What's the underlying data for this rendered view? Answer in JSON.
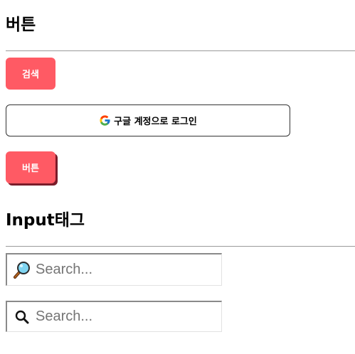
{
  "sections": {
    "buttons": {
      "title": "버튼"
    },
    "inputs": {
      "title": "Input태그"
    }
  },
  "buttons": {
    "search_label": "검색",
    "google_login_label": "구글 계정으로 로그인",
    "shadow_button_label": "버튼"
  },
  "inputs": {
    "search_emoji": {
      "placeholder": "Search...",
      "value": ""
    },
    "search_icon": {
      "placeholder": "Search...",
      "value": ""
    }
  },
  "colors": {
    "accent": "#ff5a64",
    "button_shadow": "#7a1c2a",
    "divider": "#9a9a9a"
  },
  "icons": {
    "google": "google-g-icon",
    "magnifier_emoji": "magnifying-glass-emoji-icon",
    "magnifier": "search-icon"
  }
}
